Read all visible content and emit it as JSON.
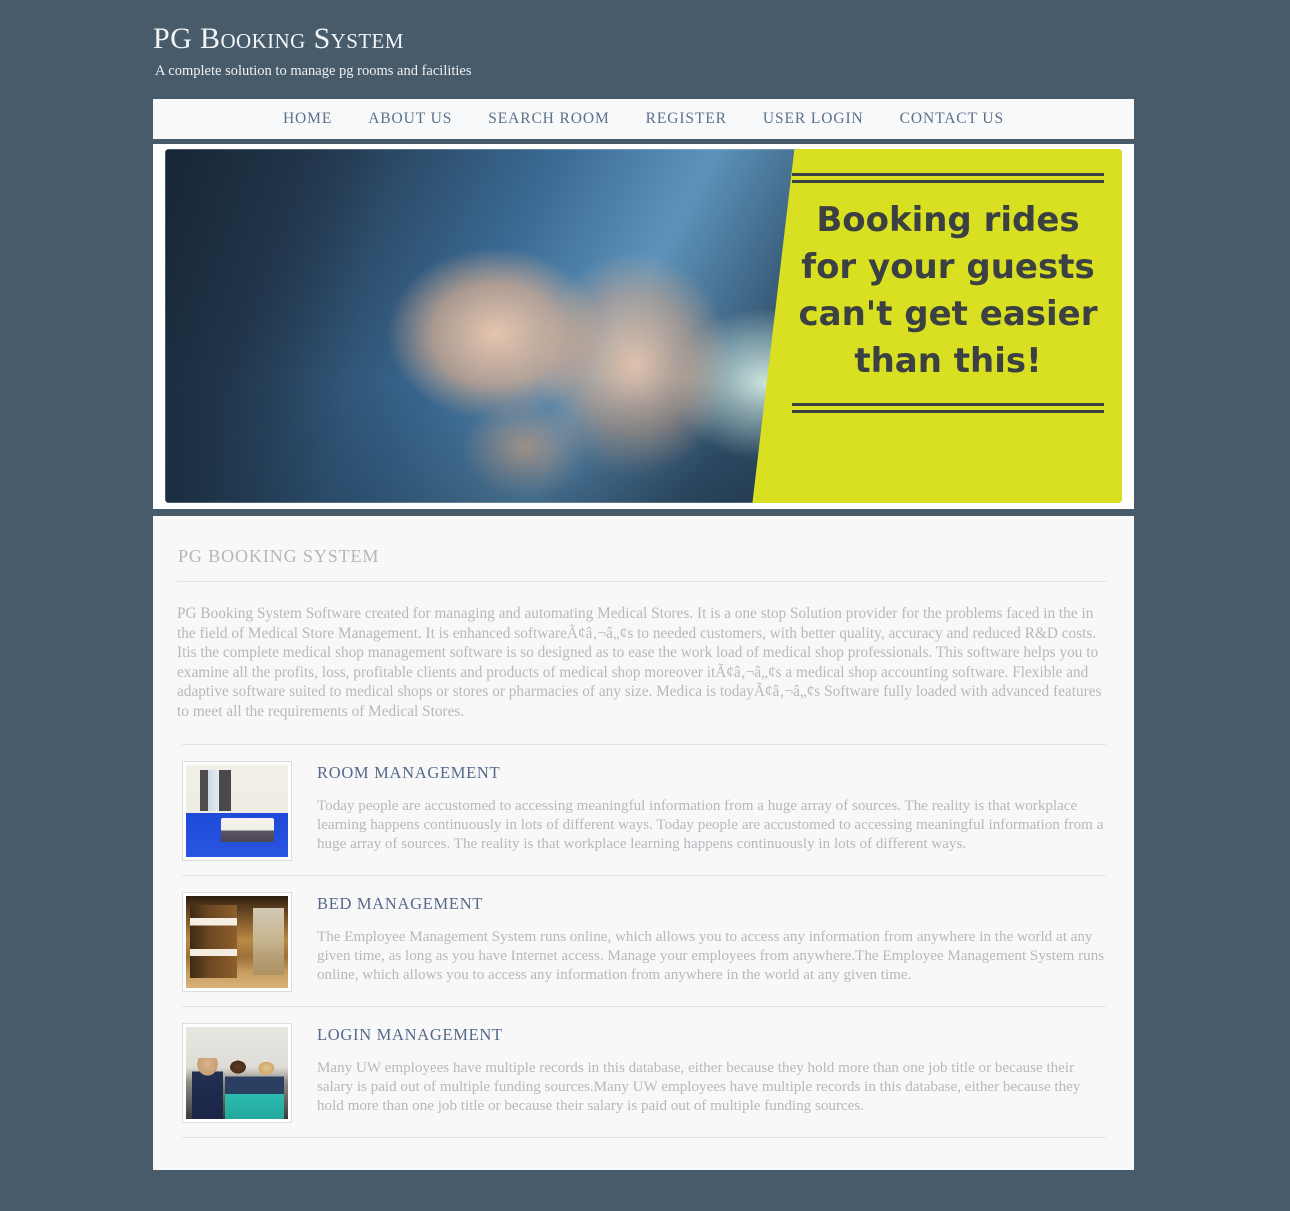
{
  "site": {
    "title": "PG Booking System",
    "tagline": "A complete solution to manage pg rooms and facilities"
  },
  "nav": {
    "items": [
      {
        "label": "HOME",
        "name": "nav-home"
      },
      {
        "label": "ABOUT US",
        "name": "nav-about-us"
      },
      {
        "label": "SEARCH ROOM",
        "name": "nav-search-room"
      },
      {
        "label": "REGISTER",
        "name": "nav-register"
      },
      {
        "label": "USER LOGIN",
        "name": "nav-user-login"
      },
      {
        "label": "CONTACT US",
        "name": "nav-contact-us"
      }
    ]
  },
  "banner": {
    "image_alt": "hands holding a smartphone",
    "panel_color": "#d9e021",
    "text_color": "#3b4042",
    "lines": [
      "Booking rides",
      "for your guests",
      "can't get easier",
      "than this!"
    ]
  },
  "content": {
    "section_title": "PG BOOKING SYSTEM",
    "intro": "PG Booking System Software created for managing and automating Medical Stores. It is a one stop Solution provider for the problems faced in the in the field of Medical Store Management. It is enhanced softwareÃ¢â‚¬â„¢s to needed customers, with better quality, accuracy and reduced R&D costs. Itis the complete medical shop management software is so designed as to ease the work load of medical shop professionals. This software helps you to examine all the profits, loss, profitable clients and products of medical shop moreover itÃ¢â‚¬â„¢s a medical shop accounting software. Flexible and adaptive software suited to medical shops or stores or pharmacies of any size. Medica is todayÃ¢â‚¬â„¢s Software fully loaded with advanced features to meet all the requirements of Medical Stores.",
    "features": [
      {
        "title": "ROOM MANAGEMENT",
        "text": "Today people are accustomed to accessing meaningful information from a huge array of sources. The reality is that workplace learning happens continuously in lots of different ways. Today people are accustomed to accessing meaningful information from a huge array of sources. The reality is that workplace learning happens continuously in lots of different ways.",
        "thumb_alt": "hostel room with beds and blue floor",
        "thumb_class": "thumb-room",
        "name": "feature-room-management"
      },
      {
        "title": "BED MANAGEMENT",
        "text": "The Employee Management System runs online, which allows you to access any information from anywhere in the world at any given time, as long as you have Internet access. Manage your employees from anywhere.The Employee Management System runs online, which allows you to access any information from anywhere in the world at any given time.",
        "thumb_alt": "wooden bunk beds in a dormitory",
        "thumb_class": "thumb-bunk",
        "name": "feature-bed-management"
      },
      {
        "title": "LOGIN MANAGEMENT",
        "text": "Many UW employees have multiple records in this database, either because they hold more than one job title or because their salary is paid out of multiple funding sources.Many UW employees have multiple records in this database, either because they hold more than one job title or because their salary is paid out of multiple funding sources.",
        "thumb_alt": "three people working at a computer",
        "thumb_class": "thumb-people",
        "name": "feature-login-management"
      }
    ]
  },
  "theme": {
    "page_background": "#475b6b",
    "panel_background": "#f8f8f8",
    "nav_link_color": "#5b7189",
    "heading_color": "#55698a",
    "body_text_color": "#b6b8bd"
  }
}
